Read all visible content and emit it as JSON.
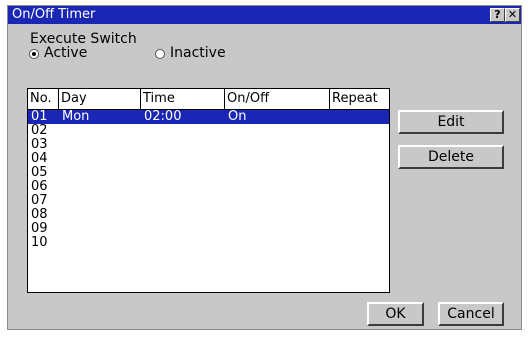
{
  "window": {
    "title": "On/Off Timer",
    "help_label": "?",
    "close_label": "✕"
  },
  "execute_switch": {
    "label": "Execute Switch",
    "options": [
      {
        "label": "Active",
        "selected": true
      },
      {
        "label": "Inactive",
        "selected": false
      }
    ]
  },
  "table": {
    "columns": [
      "No.",
      "Day",
      "Time",
      "On/Off",
      "Repeat"
    ],
    "rows": [
      {
        "no": "01",
        "day": "Mon",
        "time": "02:00",
        "onoff": "On",
        "repeat": "",
        "selected": true
      },
      {
        "no": "02",
        "day": "",
        "time": "",
        "onoff": "",
        "repeat": ""
      },
      {
        "no": "03",
        "day": "",
        "time": "",
        "onoff": "",
        "repeat": ""
      },
      {
        "no": "04",
        "day": "",
        "time": "",
        "onoff": "",
        "repeat": ""
      },
      {
        "no": "05",
        "day": "",
        "time": "",
        "onoff": "",
        "repeat": ""
      },
      {
        "no": "06",
        "day": "",
        "time": "",
        "onoff": "",
        "repeat": ""
      },
      {
        "no": "07",
        "day": "",
        "time": "",
        "onoff": "",
        "repeat": ""
      },
      {
        "no": "08",
        "day": "",
        "time": "",
        "onoff": "",
        "repeat": ""
      },
      {
        "no": "09",
        "day": "",
        "time": "",
        "onoff": "",
        "repeat": ""
      },
      {
        "no": "10",
        "day": "",
        "time": "",
        "onoff": "",
        "repeat": ""
      }
    ]
  },
  "buttons": {
    "edit": "Edit",
    "delete": "Delete",
    "ok": "OK",
    "cancel": "Cancel"
  },
  "colors": {
    "title_bar": "#1a27b5",
    "selection": "#1a27b5",
    "dialog_bg": "#c8c8c8"
  }
}
